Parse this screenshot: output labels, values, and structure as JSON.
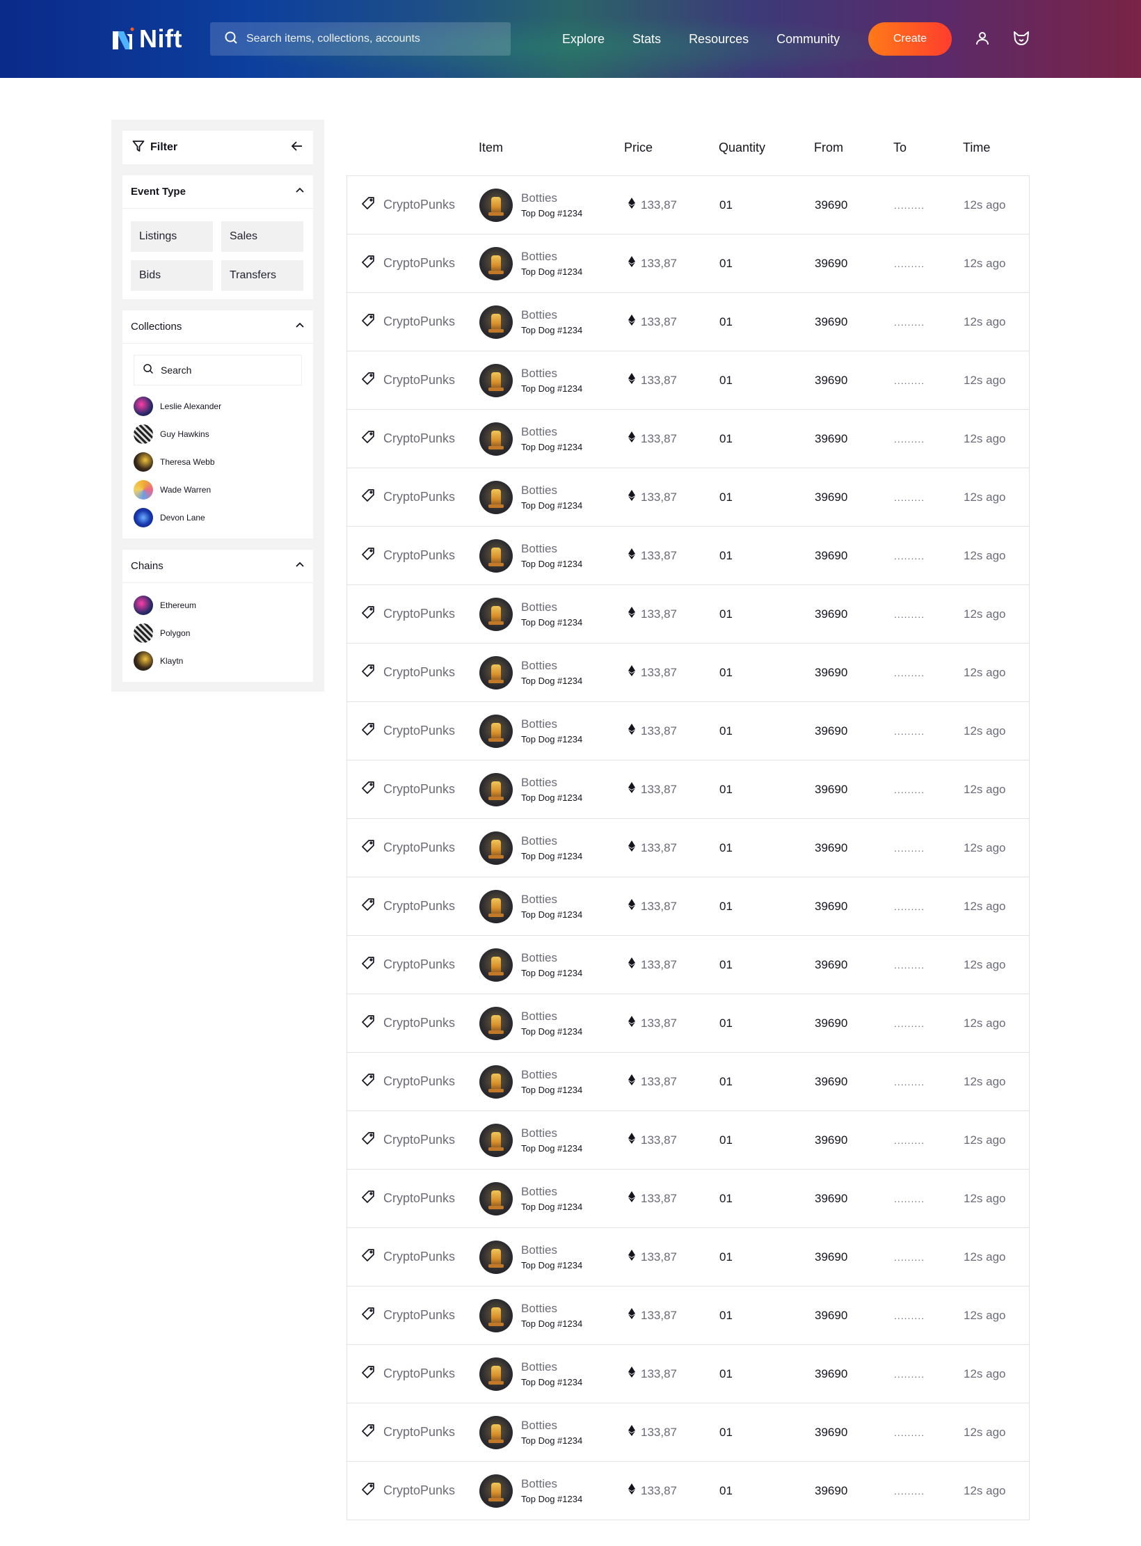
{
  "header": {
    "logo_text": "Nift",
    "search_placeholder": "Search items, collections, accounts",
    "nav": [
      "Explore",
      "Stats",
      "Resources",
      "Community"
    ],
    "create_label": "Create"
  },
  "sidebar": {
    "filter_label": "Filter",
    "event_type": {
      "title": "Event Type",
      "options": [
        "Listings",
        "Sales",
        "Bids",
        "Transfers"
      ]
    },
    "collections": {
      "title": "Collections",
      "search_placeholder": "Search",
      "items": [
        "Leslie Alexander",
        "Guy Hawkins",
        "Theresa Webb",
        "Wade Warren",
        "Devon Lane"
      ]
    },
    "chains": {
      "title": "Chains",
      "items": [
        "Ethereum",
        "Polygon",
        "Klaytn"
      ]
    }
  },
  "table": {
    "headers": [
      "Item",
      "Price",
      "Quantity",
      "From",
      "To",
      "Time"
    ],
    "rows": [
      {
        "collection": "CryptoPunks",
        "item_name": "Botties",
        "item_sub": "Top Dog #1234",
        "price": "133,87",
        "quantity": "01",
        "from": "39690",
        "to": ".........",
        "time": "12s ago"
      },
      {
        "collection": "CryptoPunks",
        "item_name": "Botties",
        "item_sub": "Top Dog #1234",
        "price": "133,87",
        "quantity": "01",
        "from": "39690",
        "to": ".........",
        "time": "12s ago"
      },
      {
        "collection": "CryptoPunks",
        "item_name": "Botties",
        "item_sub": "Top Dog #1234",
        "price": "133,87",
        "quantity": "01",
        "from": "39690",
        "to": ".........",
        "time": "12s ago"
      },
      {
        "collection": "CryptoPunks",
        "item_name": "Botties",
        "item_sub": "Top Dog #1234",
        "price": "133,87",
        "quantity": "01",
        "from": "39690",
        "to": ".........",
        "time": "12s ago"
      },
      {
        "collection": "CryptoPunks",
        "item_name": "Botties",
        "item_sub": "Top Dog #1234",
        "price": "133,87",
        "quantity": "01",
        "from": "39690",
        "to": ".........",
        "time": "12s ago"
      },
      {
        "collection": "CryptoPunks",
        "item_name": "Botties",
        "item_sub": "Top Dog #1234",
        "price": "133,87",
        "quantity": "01",
        "from": "39690",
        "to": ".........",
        "time": "12s ago"
      },
      {
        "collection": "CryptoPunks",
        "item_name": "Botties",
        "item_sub": "Top Dog #1234",
        "price": "133,87",
        "quantity": "01",
        "from": "39690",
        "to": ".........",
        "time": "12s ago"
      },
      {
        "collection": "CryptoPunks",
        "item_name": "Botties",
        "item_sub": "Top Dog #1234",
        "price": "133,87",
        "quantity": "01",
        "from": "39690",
        "to": ".........",
        "time": "12s ago"
      },
      {
        "collection": "CryptoPunks",
        "item_name": "Botties",
        "item_sub": "Top Dog #1234",
        "price": "133,87",
        "quantity": "01",
        "from": "39690",
        "to": ".........",
        "time": "12s ago"
      },
      {
        "collection": "CryptoPunks",
        "item_name": "Botties",
        "item_sub": "Top Dog #1234",
        "price": "133,87",
        "quantity": "01",
        "from": "39690",
        "to": ".........",
        "time": "12s ago"
      },
      {
        "collection": "CryptoPunks",
        "item_name": "Botties",
        "item_sub": "Top Dog #1234",
        "price": "133,87",
        "quantity": "01",
        "from": "39690",
        "to": ".........",
        "time": "12s ago"
      },
      {
        "collection": "CryptoPunks",
        "item_name": "Botties",
        "item_sub": "Top Dog #1234",
        "price": "133,87",
        "quantity": "01",
        "from": "39690",
        "to": ".........",
        "time": "12s ago"
      },
      {
        "collection": "CryptoPunks",
        "item_name": "Botties",
        "item_sub": "Top Dog #1234",
        "price": "133,87",
        "quantity": "01",
        "from": "39690",
        "to": ".........",
        "time": "12s ago"
      },
      {
        "collection": "CryptoPunks",
        "item_name": "Botties",
        "item_sub": "Top Dog #1234",
        "price": "133,87",
        "quantity": "01",
        "from": "39690",
        "to": ".........",
        "time": "12s ago"
      },
      {
        "collection": "CryptoPunks",
        "item_name": "Botties",
        "item_sub": "Top Dog #1234",
        "price": "133,87",
        "quantity": "01",
        "from": "39690",
        "to": ".........",
        "time": "12s ago"
      },
      {
        "collection": "CryptoPunks",
        "item_name": "Botties",
        "item_sub": "Top Dog #1234",
        "price": "133,87",
        "quantity": "01",
        "from": "39690",
        "to": ".........",
        "time": "12s ago"
      },
      {
        "collection": "CryptoPunks",
        "item_name": "Botties",
        "item_sub": "Top Dog #1234",
        "price": "133,87",
        "quantity": "01",
        "from": "39690",
        "to": ".........",
        "time": "12s ago"
      },
      {
        "collection": "CryptoPunks",
        "item_name": "Botties",
        "item_sub": "Top Dog #1234",
        "price": "133,87",
        "quantity": "01",
        "from": "39690",
        "to": ".........",
        "time": "12s ago"
      },
      {
        "collection": "CryptoPunks",
        "item_name": "Botties",
        "item_sub": "Top Dog #1234",
        "price": "133,87",
        "quantity": "01",
        "from": "39690",
        "to": ".........",
        "time": "12s ago"
      },
      {
        "collection": "CryptoPunks",
        "item_name": "Botties",
        "item_sub": "Top Dog #1234",
        "price": "133,87",
        "quantity": "01",
        "from": "39690",
        "to": ".........",
        "time": "12s ago"
      },
      {
        "collection": "CryptoPunks",
        "item_name": "Botties",
        "item_sub": "Top Dog #1234",
        "price": "133,87",
        "quantity": "01",
        "from": "39690",
        "to": ".........",
        "time": "12s ago"
      },
      {
        "collection": "CryptoPunks",
        "item_name": "Botties",
        "item_sub": "Top Dog #1234",
        "price": "133,87",
        "quantity": "01",
        "from": "39690",
        "to": ".........",
        "time": "12s ago"
      },
      {
        "collection": "CryptoPunks",
        "item_name": "Botties",
        "item_sub": "Top Dog #1234",
        "price": "133,87",
        "quantity": "01",
        "from": "39690",
        "to": ".........",
        "time": "12s ago"
      }
    ]
  },
  "colors": {
    "accent": "#ff5a1f",
    "muted_text": "#6b6b78",
    "border": "#e2e2e4",
    "sidebar_bg": "#f3f3f4"
  },
  "icons": {
    "search": "search-icon",
    "filter": "filter-icon",
    "back": "arrow-left-icon",
    "collapse": "chevron-up-icon",
    "tag": "tag-icon",
    "currency": "ethereum-icon",
    "user": "user-icon",
    "wallet": "wallet-icon"
  }
}
